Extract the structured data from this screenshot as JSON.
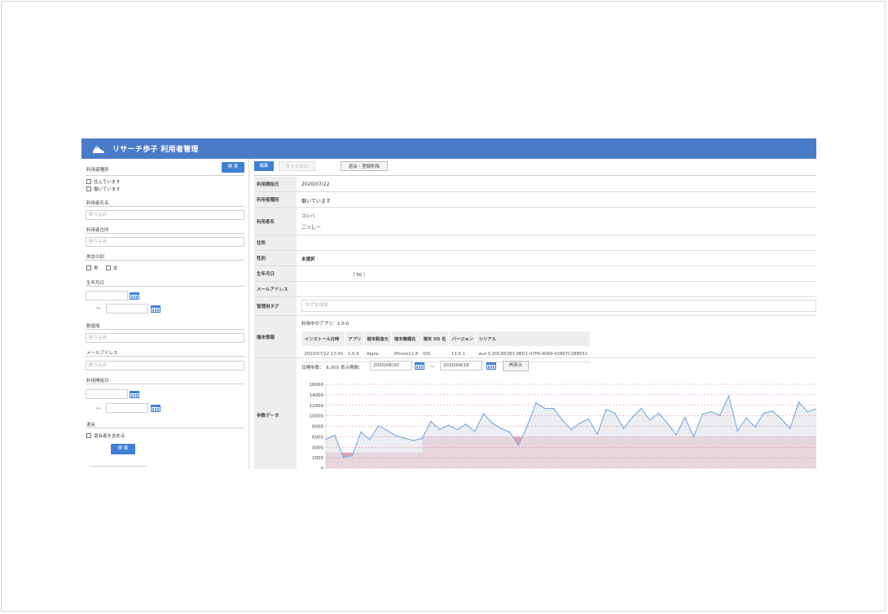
{
  "app": {
    "title": "リサーチ歩子 利用者管理",
    "accent": "#4a7bc8",
    "button_color": "#3f7fd6"
  },
  "sidebar": {
    "user_type_label": "利用者種別",
    "search_top_button": "検 索",
    "user_type_options": [
      "住んでいます",
      "働いています"
    ],
    "user_name_label": "利用者氏名",
    "user_name_placeholder": "絞り込み",
    "address_label": "利用者住所",
    "address_placeholder": "絞り込み",
    "gender_label": "男女の別",
    "gender_options": [
      "男",
      "女"
    ],
    "birthdate_label": "生年月日",
    "age_label": "数値域",
    "age_placeholder": "絞り込み",
    "email_label": "メールアドレス",
    "email_placeholder": "絞り込み",
    "start_date_label": "利用開始日",
    "withdraw_label": "退会",
    "withdraw_option": "退会者を含める",
    "search_bottom_button": "検 索",
    "range_tilde": "〜"
  },
  "toolbar": {
    "edit": "編集",
    "cancel": "キャンセル",
    "withdraw": "退会・登録削除"
  },
  "detail": {
    "start_date": {
      "label": "利用開始日",
      "value": "2020/07/22"
    },
    "user_type": {
      "label": "利用者種別",
      "value": "働いています"
    },
    "user_name": {
      "label": "利用者名",
      "kana": "コシバ",
      "name": "ごっしー"
    },
    "address": {
      "label": "住所",
      "value": ""
    },
    "gender": {
      "label": "性別",
      "value": "未選択"
    },
    "birthdate": {
      "label": "生年月日",
      "value": "（ 50 ）"
    },
    "email": {
      "label": "メールアドレス",
      "value": ""
    },
    "tags": {
      "label": "管理用タグ",
      "placeholder": "タグを追加"
    },
    "device": {
      "label": "端末情報",
      "app_version_text": "利用中のアプリ：1.0.0",
      "headers": [
        "インストール日時",
        "アプリ",
        "端末製造元",
        "端末機種名",
        "端末 OS 名",
        "バージョン",
        "シリアル"
      ],
      "rows": [
        [
          "2020/07/22 17:43",
          "1.0.9",
          "Apple",
          "iPhone11,8",
          "iOS",
          "13.5.1",
          "wui-3-2DC86383-9BD1-47FA-9069-42867C38B051"
        ]
      ]
    },
    "steps": {
      "label": "歩数データ",
      "goal_text": "目標歩数：　6,000",
      "period_label": "表示期間：",
      "from_date": "2020/06/20",
      "tilde": "〜",
      "to_date": "2020/09/18",
      "redisplay": "再表示"
    }
  },
  "chart_data": {
    "type": "area",
    "title": "",
    "xlabel": "",
    "ylabel": "",
    "ylim": [
      0,
      16000
    ],
    "yticks": [
      0,
      2000,
      4000,
      6000,
      8000,
      10000,
      12000,
      14000,
      16000
    ],
    "grid": true,
    "goal_band": [
      {
        "start_index": 0,
        "end_index": 11,
        "value": 3000
      },
      {
        "start_index": 11,
        "end_index": 65,
        "value": 6000
      }
    ],
    "goal_color": "#e8a3b3",
    "line_color": "#7fb0e0",
    "fill_color": "#e6e8ec",
    "series": [
      {
        "values": [
          5500,
          6300,
          2100,
          2400,
          6900,
          5500,
          8100,
          7200,
          6200,
          5700,
          5300,
          5700,
          8900,
          7400,
          8200,
          7400,
          8400,
          7000,
          10400,
          8600,
          7600,
          6900,
          4400,
          8100,
          12500,
          11400,
          11400,
          9200,
          7400,
          8600,
          9400,
          6500,
          11200,
          10500,
          7600,
          9700,
          11400,
          9200,
          10500,
          8600,
          6400,
          9700,
          6000,
          10300,
          10800,
          10100,
          13800,
          7100,
          9600,
          7900,
          10500,
          10900,
          9400,
          7600,
          12600,
          10800,
          11300
        ]
      }
    ]
  }
}
